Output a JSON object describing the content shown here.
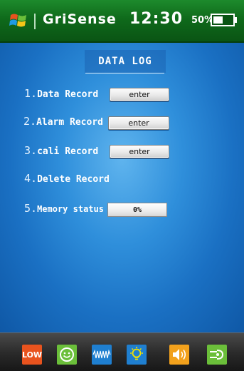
{
  "header": {
    "brand": "GriSense",
    "time": "12:30",
    "battery_percent_label": "50%",
    "battery_level": 0.5,
    "background_color": "#0f6a1b"
  },
  "page": {
    "title": "DATA LOG"
  },
  "menu": [
    {
      "number": "1.",
      "label": "Data Record",
      "button": "enter"
    },
    {
      "number": "2.",
      "label": "Alarm Record",
      "button": "enter"
    },
    {
      "number": "3.",
      "label": "cali Record",
      "button": "enter"
    },
    {
      "number": "4.",
      "label": "Delete Record"
    },
    {
      "number": "5.",
      "label": "Memory status",
      "value": "0%"
    }
  ],
  "bottom_bar": {
    "icons": [
      {
        "name": "low-battery-icon",
        "text": "LOW",
        "color": "#e8531e"
      },
      {
        "name": "smiley-icon",
        "color": "#6bbf3a"
      },
      {
        "name": "waveform-icon",
        "color": "#1f7fd0"
      },
      {
        "name": "lightbulb-icon",
        "color": "#1f7fd0"
      },
      {
        "name": "speaker-icon",
        "color": "#f2a11c"
      },
      {
        "name": "sensor-icon",
        "color": "#6bbf3a"
      }
    ]
  },
  "colors": {
    "main_background": "#2f8fdb",
    "bottom_bar": "#2b2b2b"
  }
}
